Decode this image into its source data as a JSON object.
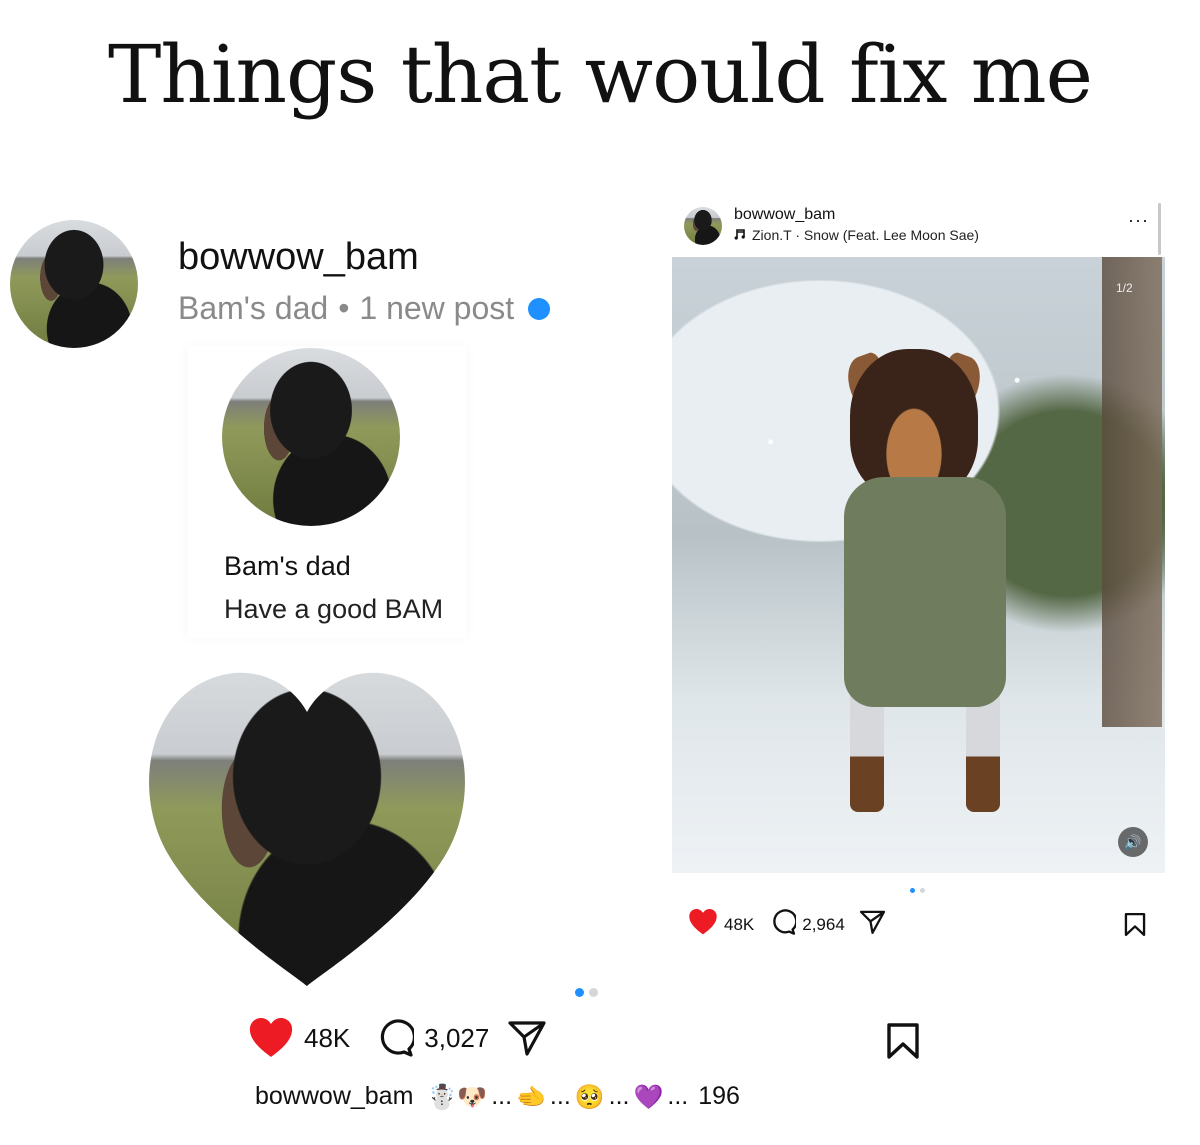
{
  "title": "Things that would fix me",
  "profile": {
    "username": "bowwow_bam",
    "display_name": "Bam's dad",
    "separator": "•",
    "new_post_text": "1 new post"
  },
  "card": {
    "name": "Bam's dad",
    "status": "Have a good BAM"
  },
  "left_post": {
    "likes": "48K",
    "comments": "3,027",
    "pager_active": 0,
    "pager_count": 2
  },
  "caption": {
    "username": "bowwow_bam",
    "emoji_1": "☃️🐶",
    "ellipsis_1": "...",
    "emoji_2": "🫲",
    "ellipsis_2": "...",
    "emoji_3": "🥺",
    "ellipsis_3": "...",
    "emoji_4": "💜",
    "ellipsis_4": "...",
    "count": "196"
  },
  "right_post": {
    "username": "bowwow_bam",
    "music": "Zion.T · Snow (Feat. Lee Moon Sae)",
    "more": "···",
    "counter": "1/2",
    "likes": "48K",
    "comments": "2,964"
  },
  "colors": {
    "accent_blue": "#1e90ff",
    "heart_red": "#ed1c24",
    "muted_text": "#8a8a8a"
  },
  "icons": [
    "heart-icon",
    "comment-icon",
    "share-icon",
    "bookmark-icon",
    "music-note-icon",
    "sound-icon",
    "more-icon"
  ]
}
